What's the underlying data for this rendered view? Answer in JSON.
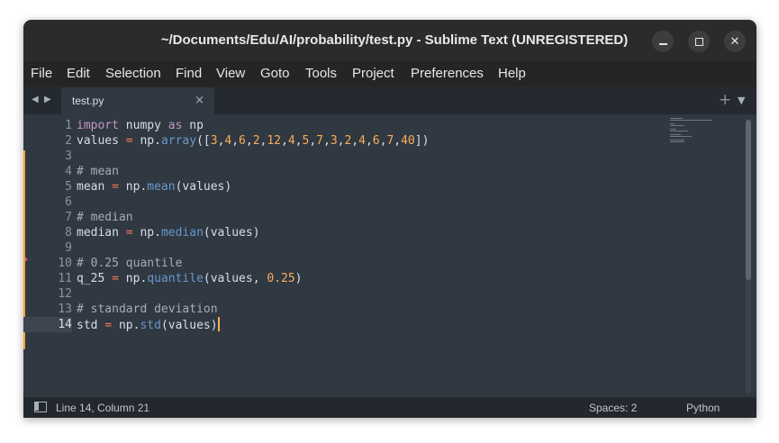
{
  "window": {
    "title": "~/Documents/Edu/AI/probability/test.py - Sublime Text (UNREGISTERED)"
  },
  "menu": [
    "File",
    "Edit",
    "Selection",
    "Find",
    "View",
    "Goto",
    "Tools",
    "Project",
    "Preferences",
    "Help"
  ],
  "tabs": [
    {
      "label": "test.py",
      "close": "×",
      "active": true
    }
  ],
  "tabbar": {
    "new_tab": "+",
    "nav_back": "◀",
    "nav_fwd": "▶",
    "menu": "▼"
  },
  "editor": {
    "line_numbers": [
      "1",
      "2",
      "3",
      "4",
      "5",
      "6",
      "7",
      "8",
      "9",
      "10",
      "11",
      "12",
      "13",
      "14"
    ],
    "active_line": 14,
    "lines": [
      "import numpy as np",
      "values = np.array([3,4,6,2,12,4,5,7,3,2,4,6,7,40])",
      "",
      "# mean",
      "mean = np.mean(values)",
      "",
      "# median",
      "median = np.median(values)",
      "",
      "# 0.25 quantile",
      "q_25 = np.quantile(values, 0.25)",
      "",
      "# standard deviation",
      "std = np.std(values)"
    ],
    "colors": {
      "background": "#303841",
      "keyword": "#c695c6",
      "function": "#6699cc",
      "number": "#f9ae58",
      "operator": "#f97b58",
      "comment": "#a6acb9",
      "modified_marker": "#f5a623"
    }
  },
  "statusbar": {
    "position": "Line 14, Column 21",
    "spaces": "Spaces: 2",
    "syntax": "Python"
  }
}
